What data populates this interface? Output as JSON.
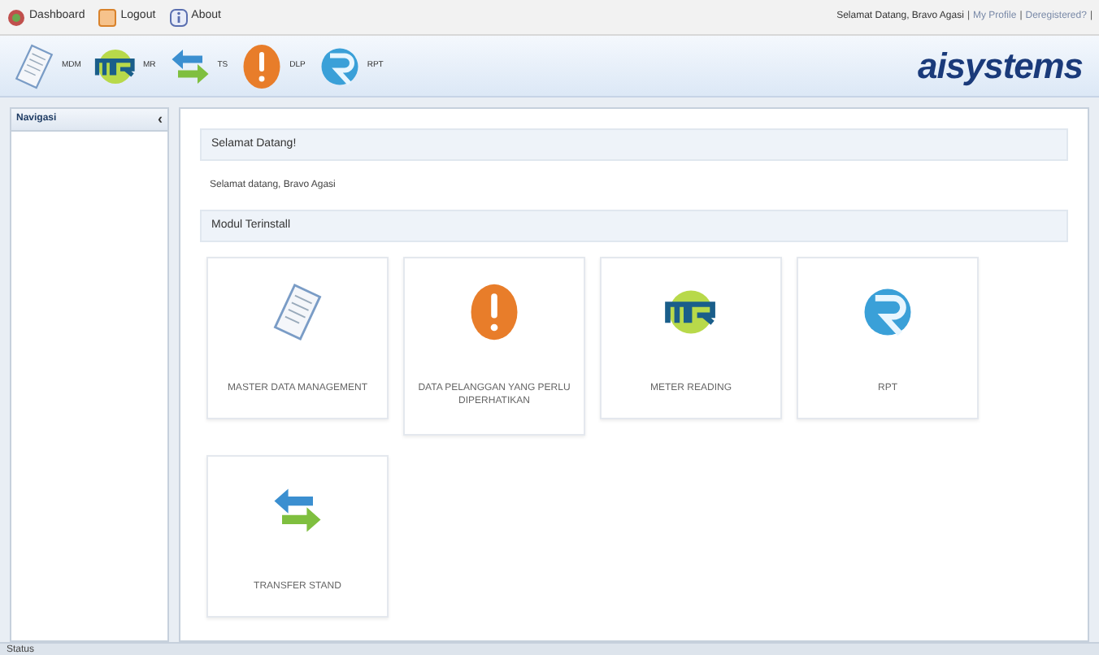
{
  "top_links": [
    {
      "kind": "dashboard",
      "label": "Dashboard"
    },
    {
      "kind": "logout",
      "label": "Logout"
    },
    {
      "kind": "about",
      "label": "About"
    }
  ],
  "user_links": [
    "Selamat Datang, Bravo Agasi",
    "My Profile",
    "Deregistered?"
  ],
  "user_link_separators": [
    "|",
    "|",
    "|"
  ],
  "toolbar": [
    {
      "kind": "doc",
      "label": "MDM"
    },
    {
      "kind": "mr",
      "label": "MR"
    },
    {
      "kind": "transfer",
      "label": "TS"
    },
    {
      "kind": "alert",
      "label": "DLP"
    },
    {
      "kind": "r",
      "label": "RPT"
    }
  ],
  "logo": "aisystems",
  "sidebar": {
    "title": "Navigasi",
    "collapse": "‹"
  },
  "welcome": {
    "title": "Selamat Datang!",
    "text": "Selamat datang, Bravo Agasi"
  },
  "modules": {
    "title": "Modul Terinstall",
    "items": [
      {
        "kind": "doc",
        "label": "MASTER DATA MANAGEMENT"
      },
      {
        "kind": "alert",
        "label": "DATA PELANGGAN YANG PERLU DIPERHATIKAN"
      },
      {
        "kind": "mr",
        "label": "METER READING"
      },
      {
        "kind": "r",
        "label": "RPT"
      },
      {
        "kind": "transfer",
        "label": "TRANSFER STAND"
      }
    ]
  },
  "status_bar": "Status"
}
